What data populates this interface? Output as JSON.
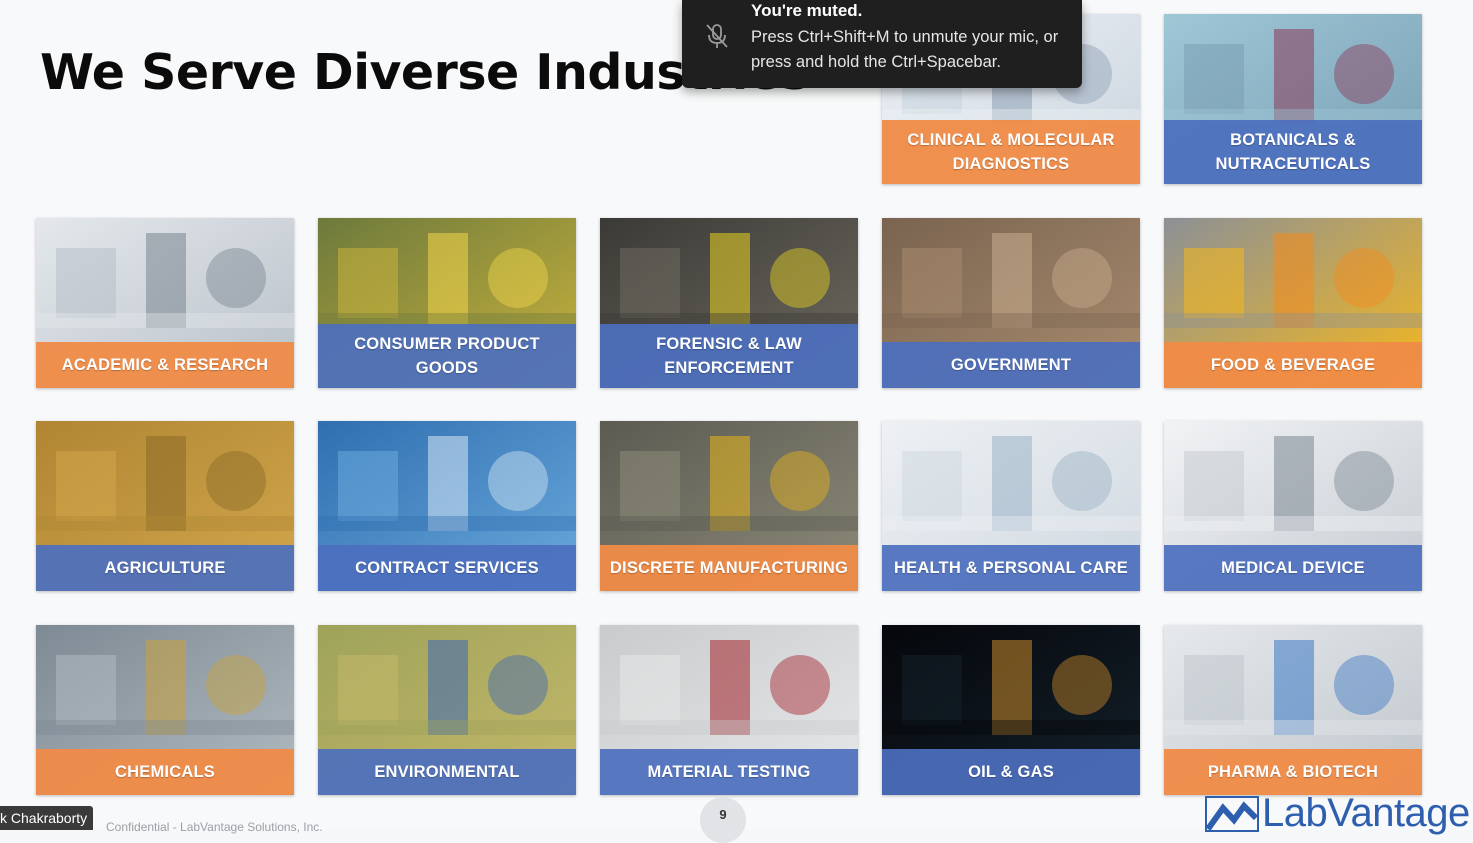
{
  "slide": {
    "title": "We Serve Diverse Industries",
    "page_number": "9",
    "footer_text": "Confidential - LabVantage Solutions, Inc.",
    "logo_text": "LabVantage"
  },
  "tiles": [
    {
      "label": "CLINICAL & MOLECULAR DIAGNOSTICS",
      "color": "orange",
      "photo": "lab-technician-photo"
    },
    {
      "label": "BOTANICALS & NUTRACEUTICALS",
      "color": "blue",
      "photo": "petri-dishes-photo"
    },
    {
      "label": "ACADEMIC & RESEARCH",
      "color": "orange",
      "photo": "research-lab-photo"
    },
    {
      "label": "CONSUMER PRODUCT GOODS",
      "color": "blue",
      "photo": "bottles-shelf-photo"
    },
    {
      "label": "FORENSIC & LAW ENFORCEMENT",
      "color": "blue",
      "photo": "crime-scene-photo"
    },
    {
      "label": "GOVERNMENT",
      "color": "blue",
      "photo": "government-building-photo"
    },
    {
      "label": "FOOD & BEVERAGE",
      "color": "orange",
      "photo": "juice-bottles-photo"
    },
    {
      "label": "AGRICULTURE",
      "color": "blue",
      "photo": "harvester-field-photo"
    },
    {
      "label": "CONTRACT SERVICES",
      "color": "blue",
      "photo": "lab-workstation-photo"
    },
    {
      "label": "DISCRETE MANUFACTURING",
      "color": "orange",
      "photo": "robot-arm-photo"
    },
    {
      "label": "HEALTH & PERSONAL CARE",
      "color": "blue",
      "photo": "pharmacy-shelves-photo"
    },
    {
      "label": "MEDICAL DEVICE",
      "color": "blue",
      "photo": "scientist-lab-photo"
    },
    {
      "label": "CHEMICALS",
      "color": "orange",
      "photo": "chemical-plant-photo"
    },
    {
      "label": "ENVIRONMENTAL",
      "color": "blue",
      "photo": "water-sample-photo"
    },
    {
      "label": "MATERIAL TESTING",
      "color": "blue",
      "photo": "test-tube-photo"
    },
    {
      "label": "OIL & GAS",
      "color": "blue",
      "photo": "refinery-night-photo"
    },
    {
      "label": "PHARMA & BIOTECH",
      "color": "orange",
      "photo": "lab-equipment-photo"
    }
  ],
  "mute_toast": {
    "title": "You're muted.",
    "message": "Press Ctrl+Shift+M to unmute your mic, or press and hold the Ctrl+Spacebar.",
    "icon": "mic-off-icon"
  },
  "participant": {
    "name": "k Chakraborty"
  },
  "colors": {
    "orange": "#f08b47",
    "blue": "#4c6fbe",
    "title": "#0b0b0b",
    "logo": "#2e5fae"
  }
}
